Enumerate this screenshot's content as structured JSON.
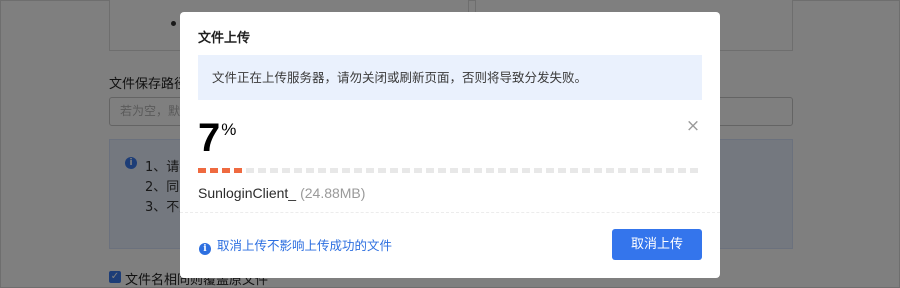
{
  "background": {
    "path_label": "文件保存路径",
    "path_placeholder": "若为空，默",
    "info_lines": [
      "1、请在",
      "2、同时",
      "3、不支"
    ],
    "checkbox_label": "文件名相同则覆盖原文件",
    "checkbox_checked": true
  },
  "dialog": {
    "title": "文件上传",
    "notice": "文件正在上传服务器，请勿关闭或刷新页面，否则将导致分发失败。",
    "progress": {
      "percent": 7,
      "percent_symbol": "%",
      "fill_color": "#ef6a40",
      "track_color": "#e8e8e8",
      "filled_segments": 4,
      "total_segments": 42
    },
    "file": {
      "name": "SunloginClient_",
      "size": "(24.88MB)"
    },
    "tip": "取消上传不影响上传成功的文件",
    "cancel_label": "取消上传",
    "close_icon": "close-icon",
    "info_icon": "info-icon"
  },
  "colors": {
    "accent": "#3475ec",
    "link": "#2d6fe0",
    "notice_bg": "#eaf1fd"
  }
}
